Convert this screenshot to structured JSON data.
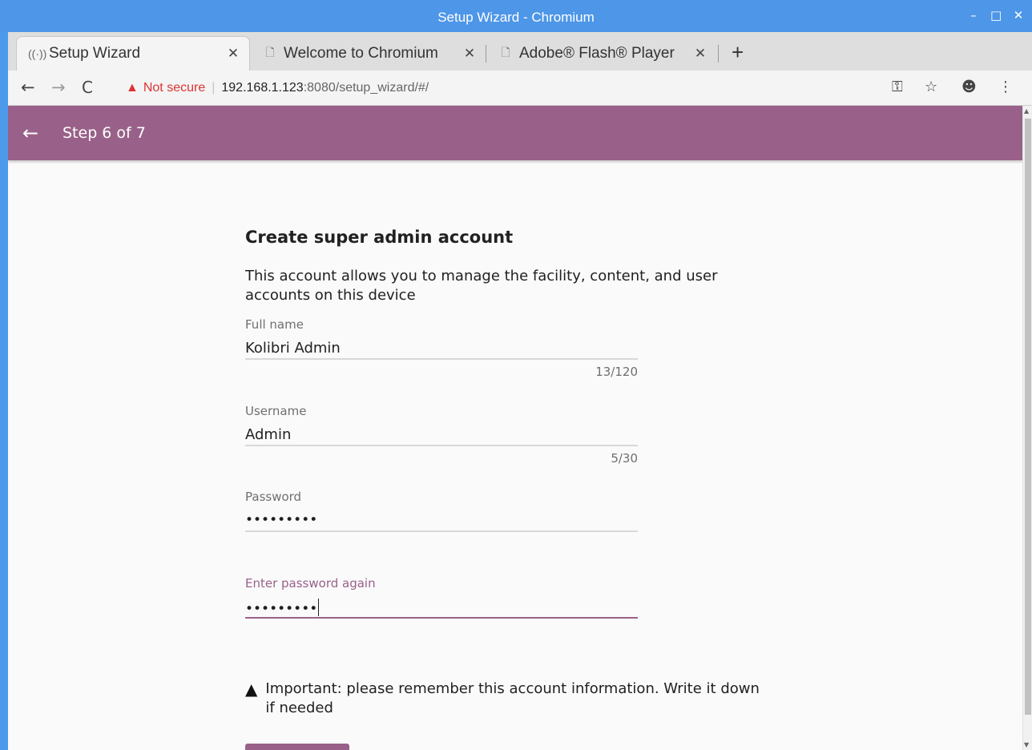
{
  "window": {
    "title": "Setup Wizard - Chromium"
  },
  "tabs": [
    {
      "label": "Setup Wizard",
      "icon": "radio-waves-icon",
      "active": true
    },
    {
      "label": "Welcome to Chromium",
      "icon": "page-icon",
      "active": false
    },
    {
      "label": "Adobe® Flash® Player",
      "icon": "page-icon",
      "active": false
    }
  ],
  "toolbar": {
    "security_label": "Not secure",
    "url_host": "192.168.1.123",
    "url_rest": ":8080/setup_wizard/#/"
  },
  "appbar": {
    "step": "Step 6 of 7"
  },
  "form": {
    "heading": "Create super admin account",
    "description": "This account allows you to manage the facility, content, and user accounts on this device",
    "full_name": {
      "label": "Full name",
      "value": "Kolibri Admin",
      "counter": "13/120"
    },
    "username": {
      "label": "Username",
      "value": "Admin",
      "counter": "5/30"
    },
    "password": {
      "label": "Password",
      "value": "•••••••••"
    },
    "password_confirm": {
      "label": "Enter password again",
      "value": "•••••••••"
    },
    "notice": "Important: please remember this account information. Write it down if needed"
  },
  "colors": {
    "accent": "#996189",
    "titlebar": "#4d96e8",
    "warning": "#d33333"
  }
}
